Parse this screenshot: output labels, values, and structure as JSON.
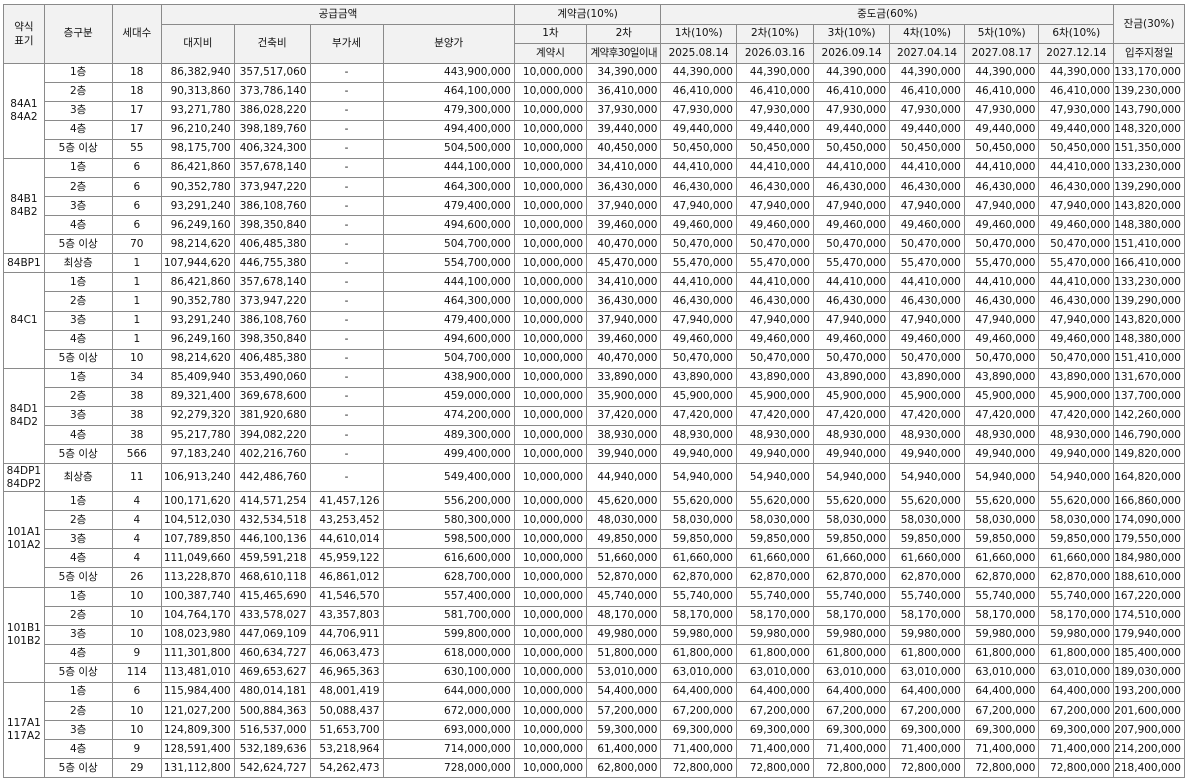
{
  "headers": {
    "type_abbr": "약식\n표기",
    "floor": "층구분",
    "households": "세대수",
    "supply_amount": "공급금액",
    "land_cost": "대지비",
    "building_cost": "건축비",
    "vat": "부가세",
    "sale_price": "분양가",
    "contract": "계약금(10%)",
    "c1": "1차",
    "c2": "2차",
    "c1_when": "계약시",
    "c2_when": "계약후30일이내",
    "middle": "중도금(60%)",
    "m1": "1차(10%)",
    "m2": "2차(10%)",
    "m3": "3차(10%)",
    "m4": "4차(10%)",
    "m5": "5차(10%)",
    "m6": "6차(10%)",
    "d1": "2025.08.14",
    "d2": "2026.03.16",
    "d3": "2026.09.14",
    "d4": "2027.04.14",
    "d5": "2027.08.17",
    "d6": "2027.12.14",
    "balance": "잔금(30%)",
    "balance_when": "입주지정일"
  },
  "groups": [
    {
      "type": "84A1\n84A2",
      "rows": [
        [
          "1층",
          "18",
          "86,382,940",
          "357,517,060",
          "-",
          "443,900,000",
          "10,000,000",
          "34,390,000",
          "44,390,000",
          "44,390,000",
          "44,390,000",
          "44,390,000",
          "44,390,000",
          "44,390,000",
          "133,170,000"
        ],
        [
          "2층",
          "18",
          "90,313,860",
          "373,786,140",
          "-",
          "464,100,000",
          "10,000,000",
          "36,410,000",
          "46,410,000",
          "46,410,000",
          "46,410,000",
          "46,410,000",
          "46,410,000",
          "46,410,000",
          "139,230,000"
        ],
        [
          "3층",
          "17",
          "93,271,780",
          "386,028,220",
          "-",
          "479,300,000",
          "10,000,000",
          "37,930,000",
          "47,930,000",
          "47,930,000",
          "47,930,000",
          "47,930,000",
          "47,930,000",
          "47,930,000",
          "143,790,000"
        ],
        [
          "4층",
          "17",
          "96,210,240",
          "398,189,760",
          "-",
          "494,400,000",
          "10,000,000",
          "39,440,000",
          "49,440,000",
          "49,440,000",
          "49,440,000",
          "49,440,000",
          "49,440,000",
          "49,440,000",
          "148,320,000"
        ],
        [
          "5층 이상",
          "55",
          "98,175,700",
          "406,324,300",
          "-",
          "504,500,000",
          "10,000,000",
          "40,450,000",
          "50,450,000",
          "50,450,000",
          "50,450,000",
          "50,450,000",
          "50,450,000",
          "50,450,000",
          "151,350,000"
        ]
      ]
    },
    {
      "type": "84B1\n84B2",
      "rows": [
        [
          "1층",
          "6",
          "86,421,860",
          "357,678,140",
          "-",
          "444,100,000",
          "10,000,000",
          "34,410,000",
          "44,410,000",
          "44,410,000",
          "44,410,000",
          "44,410,000",
          "44,410,000",
          "44,410,000",
          "133,230,000"
        ],
        [
          "2층",
          "6",
          "90,352,780",
          "373,947,220",
          "-",
          "464,300,000",
          "10,000,000",
          "36,430,000",
          "46,430,000",
          "46,430,000",
          "46,430,000",
          "46,430,000",
          "46,430,000",
          "46,430,000",
          "139,290,000"
        ],
        [
          "3층",
          "6",
          "93,291,240",
          "386,108,760",
          "-",
          "479,400,000",
          "10,000,000",
          "37,940,000",
          "47,940,000",
          "47,940,000",
          "47,940,000",
          "47,940,000",
          "47,940,000",
          "47,940,000",
          "143,820,000"
        ],
        [
          "4층",
          "6",
          "96,249,160",
          "398,350,840",
          "-",
          "494,600,000",
          "10,000,000",
          "39,460,000",
          "49,460,000",
          "49,460,000",
          "49,460,000",
          "49,460,000",
          "49,460,000",
          "49,460,000",
          "148,380,000"
        ],
        [
          "5층 이상",
          "70",
          "98,214,620",
          "406,485,380",
          "-",
          "504,700,000",
          "10,000,000",
          "40,470,000",
          "50,470,000",
          "50,470,000",
          "50,470,000",
          "50,470,000",
          "50,470,000",
          "50,470,000",
          "151,410,000"
        ]
      ]
    },
    {
      "type": "84BP1",
      "rows": [
        [
          "최상층",
          "1",
          "107,944,620",
          "446,755,380",
          "-",
          "554,700,000",
          "10,000,000",
          "45,470,000",
          "55,470,000",
          "55,470,000",
          "55,470,000",
          "55,470,000",
          "55,470,000",
          "55,470,000",
          "166,410,000"
        ]
      ]
    },
    {
      "type": "84C1",
      "rows": [
        [
          "1층",
          "1",
          "86,421,860",
          "357,678,140",
          "-",
          "444,100,000",
          "10,000,000",
          "34,410,000",
          "44,410,000",
          "44,410,000",
          "44,410,000",
          "44,410,000",
          "44,410,000",
          "44,410,000",
          "133,230,000"
        ],
        [
          "2층",
          "1",
          "90,352,780",
          "373,947,220",
          "-",
          "464,300,000",
          "10,000,000",
          "36,430,000",
          "46,430,000",
          "46,430,000",
          "46,430,000",
          "46,430,000",
          "46,430,000",
          "46,430,000",
          "139,290,000"
        ],
        [
          "3층",
          "1",
          "93,291,240",
          "386,108,760",
          "-",
          "479,400,000",
          "10,000,000",
          "37,940,000",
          "47,940,000",
          "47,940,000",
          "47,940,000",
          "47,940,000",
          "47,940,000",
          "47,940,000",
          "143,820,000"
        ],
        [
          "4층",
          "1",
          "96,249,160",
          "398,350,840",
          "-",
          "494,600,000",
          "10,000,000",
          "39,460,000",
          "49,460,000",
          "49,460,000",
          "49,460,000",
          "49,460,000",
          "49,460,000",
          "49,460,000",
          "148,380,000"
        ],
        [
          "5층 이상",
          "10",
          "98,214,620",
          "406,485,380",
          "-",
          "504,700,000",
          "10,000,000",
          "40,470,000",
          "50,470,000",
          "50,470,000",
          "50,470,000",
          "50,470,000",
          "50,470,000",
          "50,470,000",
          "151,410,000"
        ]
      ]
    },
    {
      "type": "84D1\n84D2",
      "rows": [
        [
          "1층",
          "34",
          "85,409,940",
          "353,490,060",
          "-",
          "438,900,000",
          "10,000,000",
          "33,890,000",
          "43,890,000",
          "43,890,000",
          "43,890,000",
          "43,890,000",
          "43,890,000",
          "43,890,000",
          "131,670,000"
        ],
        [
          "2층",
          "38",
          "89,321,400",
          "369,678,600",
          "-",
          "459,000,000",
          "10,000,000",
          "35,900,000",
          "45,900,000",
          "45,900,000",
          "45,900,000",
          "45,900,000",
          "45,900,000",
          "45,900,000",
          "137,700,000"
        ],
        [
          "3층",
          "38",
          "92,279,320",
          "381,920,680",
          "-",
          "474,200,000",
          "10,000,000",
          "37,420,000",
          "47,420,000",
          "47,420,000",
          "47,420,000",
          "47,420,000",
          "47,420,000",
          "47,420,000",
          "142,260,000"
        ],
        [
          "4층",
          "38",
          "95,217,780",
          "394,082,220",
          "-",
          "489,300,000",
          "10,000,000",
          "38,930,000",
          "48,930,000",
          "48,930,000",
          "48,930,000",
          "48,930,000",
          "48,930,000",
          "48,930,000",
          "146,790,000"
        ],
        [
          "5층 이상",
          "566",
          "97,183,240",
          "402,216,760",
          "-",
          "499,400,000",
          "10,000,000",
          "39,940,000",
          "49,940,000",
          "49,940,000",
          "49,940,000",
          "49,940,000",
          "49,940,000",
          "49,940,000",
          "149,820,000"
        ]
      ]
    },
    {
      "type": "84DP1\n84DP2",
      "tall": true,
      "rows": [
        [
          "최상층",
          "11",
          "106,913,240",
          "442,486,760",
          "-",
          "549,400,000",
          "10,000,000",
          "44,940,000",
          "54,940,000",
          "54,940,000",
          "54,940,000",
          "54,940,000",
          "54,940,000",
          "54,940,000",
          "164,820,000"
        ]
      ]
    },
    {
      "type": "101A1\n101A2",
      "rows": [
        [
          "1층",
          "4",
          "100,171,620",
          "414,571,254",
          "41,457,126",
          "556,200,000",
          "10,000,000",
          "45,620,000",
          "55,620,000",
          "55,620,000",
          "55,620,000",
          "55,620,000",
          "55,620,000",
          "55,620,000",
          "166,860,000"
        ],
        [
          "2층",
          "4",
          "104,512,030",
          "432,534,518",
          "43,253,452",
          "580,300,000",
          "10,000,000",
          "48,030,000",
          "58,030,000",
          "58,030,000",
          "58,030,000",
          "58,030,000",
          "58,030,000",
          "58,030,000",
          "174,090,000"
        ],
        [
          "3층",
          "4",
          "107,789,850",
          "446,100,136",
          "44,610,014",
          "598,500,000",
          "10,000,000",
          "49,850,000",
          "59,850,000",
          "59,850,000",
          "59,850,000",
          "59,850,000",
          "59,850,000",
          "59,850,000",
          "179,550,000"
        ],
        [
          "4층",
          "4",
          "111,049,660",
          "459,591,218",
          "45,959,122",
          "616,600,000",
          "10,000,000",
          "51,660,000",
          "61,660,000",
          "61,660,000",
          "61,660,000",
          "61,660,000",
          "61,660,000",
          "61,660,000",
          "184,980,000"
        ],
        [
          "5층 이상",
          "26",
          "113,228,870",
          "468,610,118",
          "46,861,012",
          "628,700,000",
          "10,000,000",
          "52,870,000",
          "62,870,000",
          "62,870,000",
          "62,870,000",
          "62,870,000",
          "62,870,000",
          "62,870,000",
          "188,610,000"
        ]
      ]
    },
    {
      "type": "101B1\n101B2",
      "rows": [
        [
          "1층",
          "10",
          "100,387,740",
          "415,465,690",
          "41,546,570",
          "557,400,000",
          "10,000,000",
          "45,740,000",
          "55,740,000",
          "55,740,000",
          "55,740,000",
          "55,740,000",
          "55,740,000",
          "55,740,000",
          "167,220,000"
        ],
        [
          "2층",
          "10",
          "104,764,170",
          "433,578,027",
          "43,357,803",
          "581,700,000",
          "10,000,000",
          "48,170,000",
          "58,170,000",
          "58,170,000",
          "58,170,000",
          "58,170,000",
          "58,170,000",
          "58,170,000",
          "174,510,000"
        ],
        [
          "3층",
          "10",
          "108,023,980",
          "447,069,109",
          "44,706,911",
          "599,800,000",
          "10,000,000",
          "49,980,000",
          "59,980,000",
          "59,980,000",
          "59,980,000",
          "59,980,000",
          "59,980,000",
          "59,980,000",
          "179,940,000"
        ],
        [
          "4층",
          "9",
          "111,301,800",
          "460,634,727",
          "46,063,473",
          "618,000,000",
          "10,000,000",
          "51,800,000",
          "61,800,000",
          "61,800,000",
          "61,800,000",
          "61,800,000",
          "61,800,000",
          "61,800,000",
          "185,400,000"
        ],
        [
          "5층 이상",
          "114",
          "113,481,010",
          "469,653,627",
          "46,965,363",
          "630,100,000",
          "10,000,000",
          "53,010,000",
          "63,010,000",
          "63,010,000",
          "63,010,000",
          "63,010,000",
          "63,010,000",
          "63,010,000",
          "189,030,000"
        ]
      ]
    },
    {
      "type": "117A1\n117A2",
      "rows": [
        [
          "1층",
          "6",
          "115,984,400",
          "480,014,181",
          "48,001,419",
          "644,000,000",
          "10,000,000",
          "54,400,000",
          "64,400,000",
          "64,400,000",
          "64,400,000",
          "64,400,000",
          "64,400,000",
          "64,400,000",
          "193,200,000"
        ],
        [
          "2층",
          "10",
          "121,027,200",
          "500,884,363",
          "50,088,437",
          "672,000,000",
          "10,000,000",
          "57,200,000",
          "67,200,000",
          "67,200,000",
          "67,200,000",
          "67,200,000",
          "67,200,000",
          "67,200,000",
          "201,600,000"
        ],
        [
          "3층",
          "10",
          "124,809,300",
          "516,537,000",
          "51,653,700",
          "693,000,000",
          "10,000,000",
          "59,300,000",
          "69,300,000",
          "69,300,000",
          "69,300,000",
          "69,300,000",
          "69,300,000",
          "69,300,000",
          "207,900,000"
        ],
        [
          "4층",
          "9",
          "128,591,400",
          "532,189,636",
          "53,218,964",
          "714,000,000",
          "10,000,000",
          "61,400,000",
          "71,400,000",
          "71,400,000",
          "71,400,000",
          "71,400,000",
          "71,400,000",
          "71,400,000",
          "214,200,000"
        ],
        [
          "5층 이상",
          "29",
          "131,112,800",
          "542,624,727",
          "54,262,473",
          "728,000,000",
          "10,000,000",
          "62,800,000",
          "72,800,000",
          "72,800,000",
          "72,800,000",
          "72,800,000",
          "72,800,000",
          "72,800,000",
          "218,400,000"
        ]
      ]
    }
  ]
}
